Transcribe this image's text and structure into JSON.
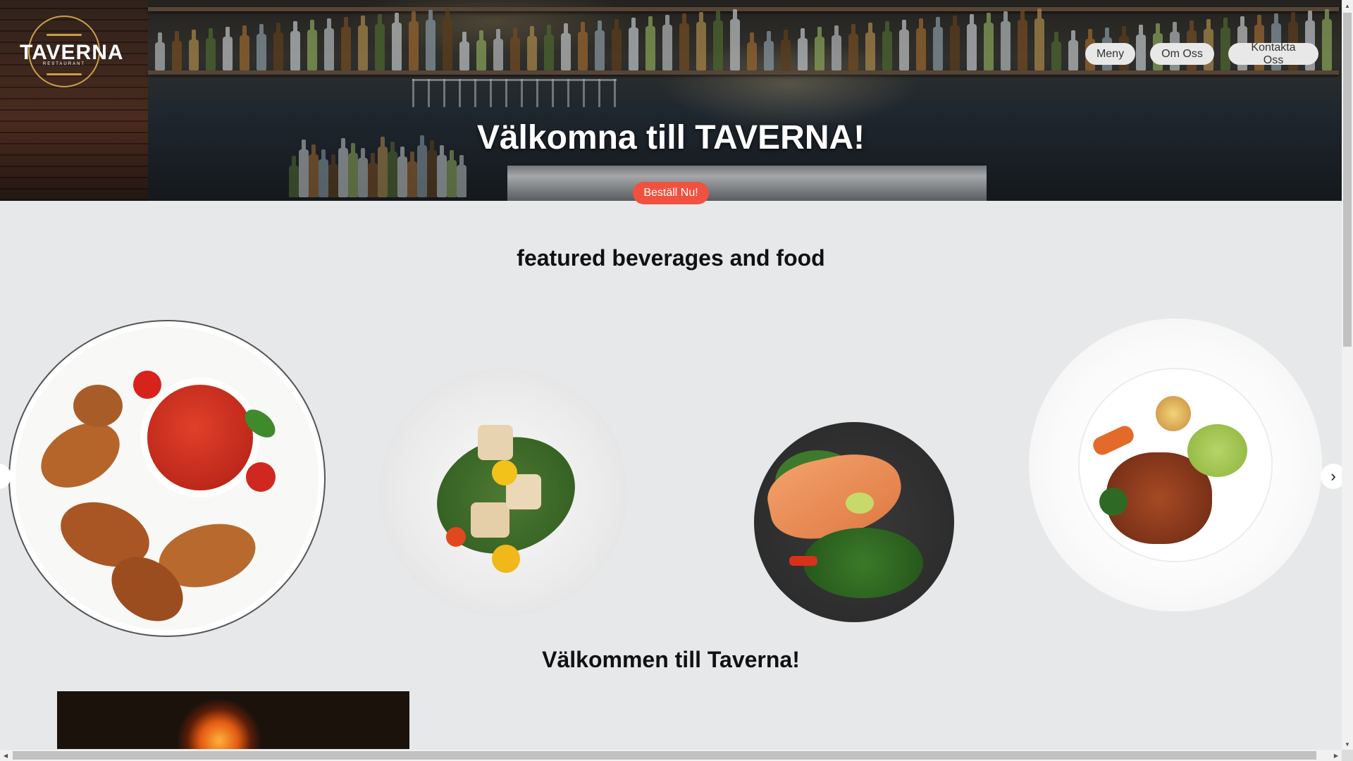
{
  "header": {
    "logo_text": "TAVERNA",
    "logo_subtext": "RESTAURANT",
    "nav": [
      {
        "label": "Meny"
      },
      {
        "label": "Om Oss"
      },
      {
        "label": "Kontakta Oss"
      }
    ]
  },
  "hero": {
    "title": "Välkomna till TAVERNA!",
    "order_button": "Beställ Nu!"
  },
  "featured": {
    "title": "featured beverages and food",
    "items": [
      {
        "icon": "chicken-wings-plate"
      },
      {
        "icon": "salad-plate"
      },
      {
        "icon": "salmon-plate"
      },
      {
        "icon": "gourmet-plate"
      }
    ],
    "prev_icon": "chevron-left-icon",
    "next_icon": "chevron-right-icon",
    "next_glyph": "›"
  },
  "welcome": {
    "title": "Välkommen till Taverna!"
  },
  "colors": {
    "accent": "#f0523f",
    "page_bg": "#e6e8e9",
    "nav_bg": "#e8e8e8"
  }
}
